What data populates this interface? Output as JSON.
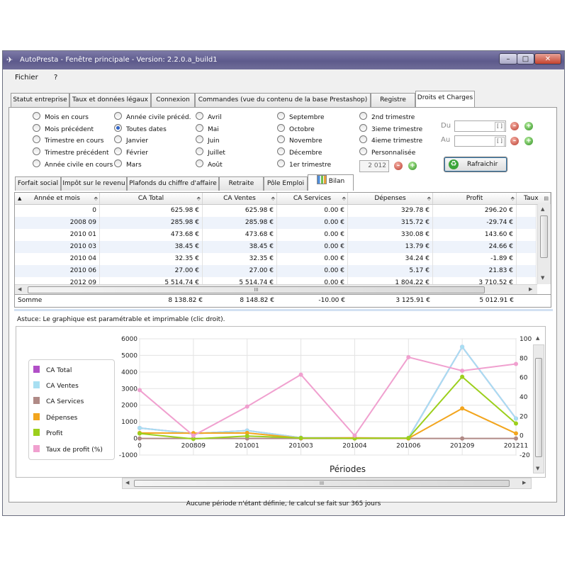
{
  "window": {
    "title": "AutoPresta - Fenêtre principale  -  Version:  2.2.0.a_build1",
    "controls": [
      "–",
      "□",
      "✕"
    ]
  },
  "menu": [
    "Fichier",
    "?"
  ],
  "main_tabs": [
    "Statut entreprise",
    "Taux et données légaux",
    "Connexion",
    "Commandes (vue du contenu de la base Prestashop)",
    "Registre",
    "Droits et Charges"
  ],
  "periods": {
    "col1": [
      "Mois en cours",
      "Mois précédent",
      "Trimestre en cours",
      "Trimestre précédent",
      "Année civile en cours"
    ],
    "col2": [
      "Année civile précéd.",
      "Toutes dates",
      "Janvier",
      "Février",
      "Mars"
    ],
    "col3": [
      "Avril",
      "Mai",
      "Juin",
      "Juillet",
      "Août"
    ],
    "col4": [
      "Septembre",
      "Octobre",
      "Novembre",
      "Décembre",
      "1er trimestre"
    ],
    "col5": [
      "2nd trimestre",
      "3ieme trimestre",
      "4ieme trimestre",
      "Personnalisée"
    ],
    "selected": "Toutes dates"
  },
  "date_range": {
    "du_label": "Du",
    "au_label": "Au",
    "du_value": "",
    "au_value": ""
  },
  "year_value": "2 012",
  "refresh_label": "Rafraichir",
  "sub_tabs": [
    "Forfait social",
    "Impôt sur le revenu",
    "Plafonds du chiffre d'affaire",
    "Retraite",
    "Pôle Emploi",
    "Bilan"
  ],
  "grid": {
    "columns": [
      "Année et mois",
      "CA Total",
      "CA Ventes",
      "CA Services",
      "Dépenses",
      "Profit",
      "Taux"
    ],
    "rows": [
      [
        "0",
        "625.98 €",
        "625.98 €",
        "0.00 €",
        "329.78 €",
        "296.20 €"
      ],
      [
        "2008   09",
        "285.98 €",
        "285.98 €",
        "0.00 €",
        "315.72 €",
        "-29.74 €"
      ],
      [
        "2010   01",
        "473.68 €",
        "473.68 €",
        "0.00 €",
        "330.08 €",
        "143.60 €"
      ],
      [
        "2010   03",
        "38.45 €",
        "38.45 €",
        "0.00 €",
        "13.79 €",
        "24.66 €"
      ],
      [
        "2010   04",
        "32.35 €",
        "32.35 €",
        "0.00 €",
        "34.24 €",
        "-1.89 €"
      ],
      [
        "2010   06",
        "27.00 €",
        "27.00 €",
        "0.00 €",
        "5.17 €",
        "21.83 €"
      ],
      [
        "2012   09",
        "5 514.74 €",
        "5 514.74 €",
        "0.00 €",
        "1 804.22 €",
        "3 710.52 €"
      ]
    ],
    "sum_label": "Somme",
    "sums": [
      "8 138.82 €",
      "8 148.82 €",
      "-10.00 €",
      "3 125.91 €",
      "5 012.91 €"
    ],
    "scroll_grip": "III"
  },
  "hint": "Astuce: Le graphique est paramétrable et imprimable (clic droit).",
  "chart_data": {
    "type": "line",
    "title": "",
    "xlabel": "Périodes",
    "ylabel": "",
    "categories": [
      "0",
      "200809",
      "201001",
      "201003",
      "201004",
      "201006",
      "201209",
      "201211"
    ],
    "ylim": [
      -1000,
      6000
    ],
    "yticks": [
      -1000,
      0,
      1000,
      2000,
      3000,
      4000,
      5000,
      6000
    ],
    "y2lim": [
      -20,
      100
    ],
    "y2ticks": [
      -20,
      0,
      20,
      40,
      60,
      80,
      100
    ],
    "grid": true,
    "legend_position": "left",
    "series": [
      {
        "name": "CA Total",
        "color": "#b14fc7",
        "axis": "left",
        "values": [
          625.98,
          285.98,
          473.68,
          38.45,
          32.35,
          27.0,
          5514.74,
          1200
        ]
      },
      {
        "name": "CA Ventes",
        "color": "#a8dff2",
        "axis": "left",
        "values": [
          625.98,
          285.98,
          473.68,
          38.45,
          32.35,
          27.0,
          5514.74,
          1200
        ]
      },
      {
        "name": "CA Services",
        "color": "#b08a86",
        "axis": "left",
        "values": [
          0,
          0,
          0,
          0,
          0,
          0,
          0,
          0
        ]
      },
      {
        "name": "Dépenses",
        "color": "#f2a51e",
        "axis": "left",
        "values": [
          329.78,
          315.72,
          330.08,
          13.79,
          34.24,
          5.17,
          1804.22,
          300
        ]
      },
      {
        "name": "Profit",
        "color": "#9ccf1c",
        "axis": "left",
        "values": [
          296.2,
          -29.74,
          143.6,
          24.66,
          -1.89,
          21.83,
          3710.52,
          900
        ]
      },
      {
        "name": "Taux de profit (%)",
        "color": "#f0a0cf",
        "axis": "right",
        "values": [
          47,
          0,
          30,
          63,
          0,
          81,
          67,
          74
        ]
      }
    ]
  },
  "chart_scroll_grip": "III",
  "status": "Aucune période n'étant définie, le calcul se fait sur 365 jours"
}
